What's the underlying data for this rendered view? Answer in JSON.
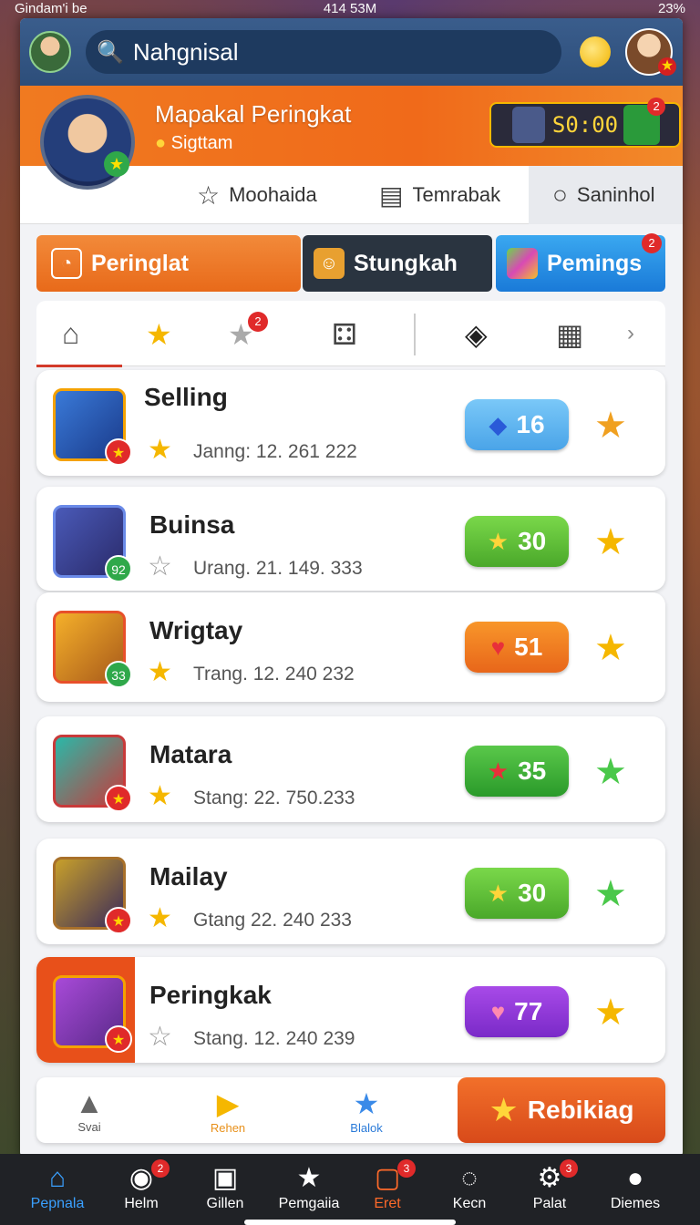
{
  "status_bar": {
    "left": "Gindam'i be",
    "center": "414 53M",
    "right": "23%"
  },
  "colors": {
    "accent_orange": "#f06a1a",
    "topbar_blue": "#2d4e7a",
    "pill_blue": "#5ab4f0",
    "pill_green": "#5ab52a",
    "pill_orange": "#f57a1a",
    "pill_purple": "#8a3ad8"
  },
  "search": {
    "value": "Nahgnisal"
  },
  "profile": {
    "title": "Mapakal Peringkat",
    "subtitle": "Sigttam",
    "timer": "S0:00",
    "timer_badge": "2"
  },
  "subtabs": [
    {
      "label": "Moohaida",
      "icon": "star-outline-icon"
    },
    {
      "label": "Temrabak",
      "icon": "document-icon"
    },
    {
      "label": "Saninhol",
      "icon": "chat-icon"
    }
  ],
  "categories": [
    {
      "label": "Peringlat",
      "icon": "timer-icon"
    },
    {
      "label": "Stungkah",
      "icon": "character-icon"
    },
    {
      "label": "Pemings",
      "icon": "cards-icon",
      "badge": "2"
    }
  ],
  "iconbar": {
    "items": [
      "home-icon",
      "star-icon",
      "star-notify-icon",
      "dice-icon",
      "gamepad-icon",
      "keyboard-icon",
      "chevron-right-icon"
    ],
    "badge": "2"
  },
  "rows": [
    {
      "name": "Selling",
      "stat": "Janng: 12. 261 222",
      "value": "16",
      "pill_icon": "gem-icon",
      "fav": "orange",
      "badge": "★"
    },
    {
      "name": "Buinsa",
      "stat": "Urang. 21. 149. 333",
      "value": "30",
      "pill_icon": "star-icon",
      "fav": "yellow",
      "badge": "92"
    },
    {
      "name": "Wrigtay",
      "stat": "Trang. 12. 240 232",
      "value": "51",
      "pill_icon": "heart-icon",
      "fav": "yellow",
      "badge": "33"
    },
    {
      "name": "Matara",
      "stat": "Stang: 22. 750.233",
      "value": "35",
      "pill_icon": "star-icon",
      "fav": "green",
      "badge": "★"
    },
    {
      "name": "Mailay",
      "stat": "Gtang 22. 240 233",
      "value": "30",
      "pill_icon": "star-icon",
      "fav": "green",
      "badge": "★"
    },
    {
      "name": "Peringkak",
      "stat": "Stang. 12. 240 239",
      "value": "77",
      "pill_icon": "heart-icon",
      "fav": "yellow",
      "badge": "★"
    }
  ],
  "bottom_strip": {
    "items": [
      {
        "label": "Svai",
        "icon": "graduation-cap-icon"
      },
      {
        "label": "Rehen",
        "icon": "play-icon"
      },
      {
        "label": "Blalok",
        "icon": "star-icon"
      }
    ],
    "cta": "Rebikiag"
  },
  "nav": [
    {
      "label": "Pepnala",
      "icon": "home-icon"
    },
    {
      "label": "Helm",
      "icon": "chart-icon",
      "badge": "2"
    },
    {
      "label": "Gillen",
      "icon": "box-icon"
    },
    {
      "label": "Pemgaiia",
      "icon": "star-icon"
    },
    {
      "label": "Eret",
      "icon": "calendar-icon",
      "badge": "3"
    },
    {
      "label": "Kecn",
      "icon": "refresh-icon"
    },
    {
      "label": "Palat",
      "icon": "gear-icon",
      "badge": "3"
    },
    {
      "label": "Diemes",
      "icon": "user-icon"
    }
  ]
}
